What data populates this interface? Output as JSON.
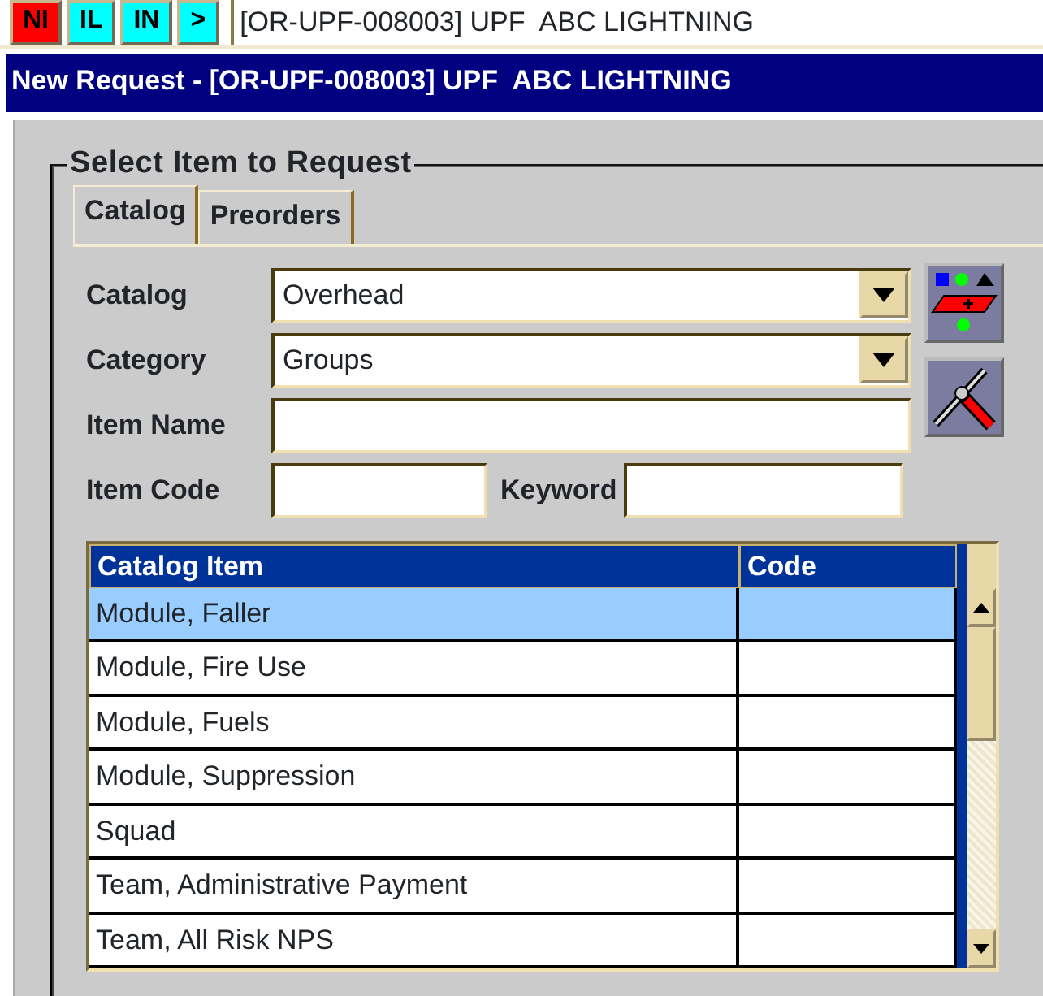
{
  "toolbar": {
    "buttons": [
      {
        "label": "NI",
        "color": "#ff0000"
      },
      {
        "label": "IL",
        "color": "#00ffff"
      },
      {
        "label": "IN",
        "color": "#00ffff"
      },
      {
        "label": ">",
        "color": "#00ffff"
      }
    ],
    "title": "[OR-UPF-008003] UPF  ABC LIGHTNING"
  },
  "window": {
    "title": "New Request - [OR-UPF-008003] UPF  ABC LIGHTNING"
  },
  "group": {
    "title": "Select Item to Request"
  },
  "tabs": [
    {
      "label": "Catalog",
      "selected": true
    },
    {
      "label": "Preorders",
      "selected": false
    }
  ],
  "fields": [
    {
      "label": "Catalog",
      "kind": "combo",
      "value": "Overhead"
    },
    {
      "label": "Category",
      "kind": "combo",
      "value": "Groups"
    },
    {
      "label": "Item Name",
      "kind": "text"
    }
  ],
  "code_row": [
    {
      "label": "Item Code"
    },
    {
      "label": "Keyword"
    }
  ],
  "table": {
    "columns": [
      "Catalog Item",
      "Code"
    ],
    "rows": [
      {
        "item": "Module, Faller",
        "selected": true
      },
      {
        "item": "Module, Fire Use",
        "selected": false
      },
      {
        "item": "Module, Fuels",
        "selected": false
      },
      {
        "item": "Module, Suppression",
        "selected": false
      },
      {
        "item": "Squad",
        "selected": false
      },
      {
        "item": "Team, Administrative Payment",
        "selected": false
      },
      {
        "item": "Team, All Risk NPS",
        "selected": false
      }
    ]
  }
}
